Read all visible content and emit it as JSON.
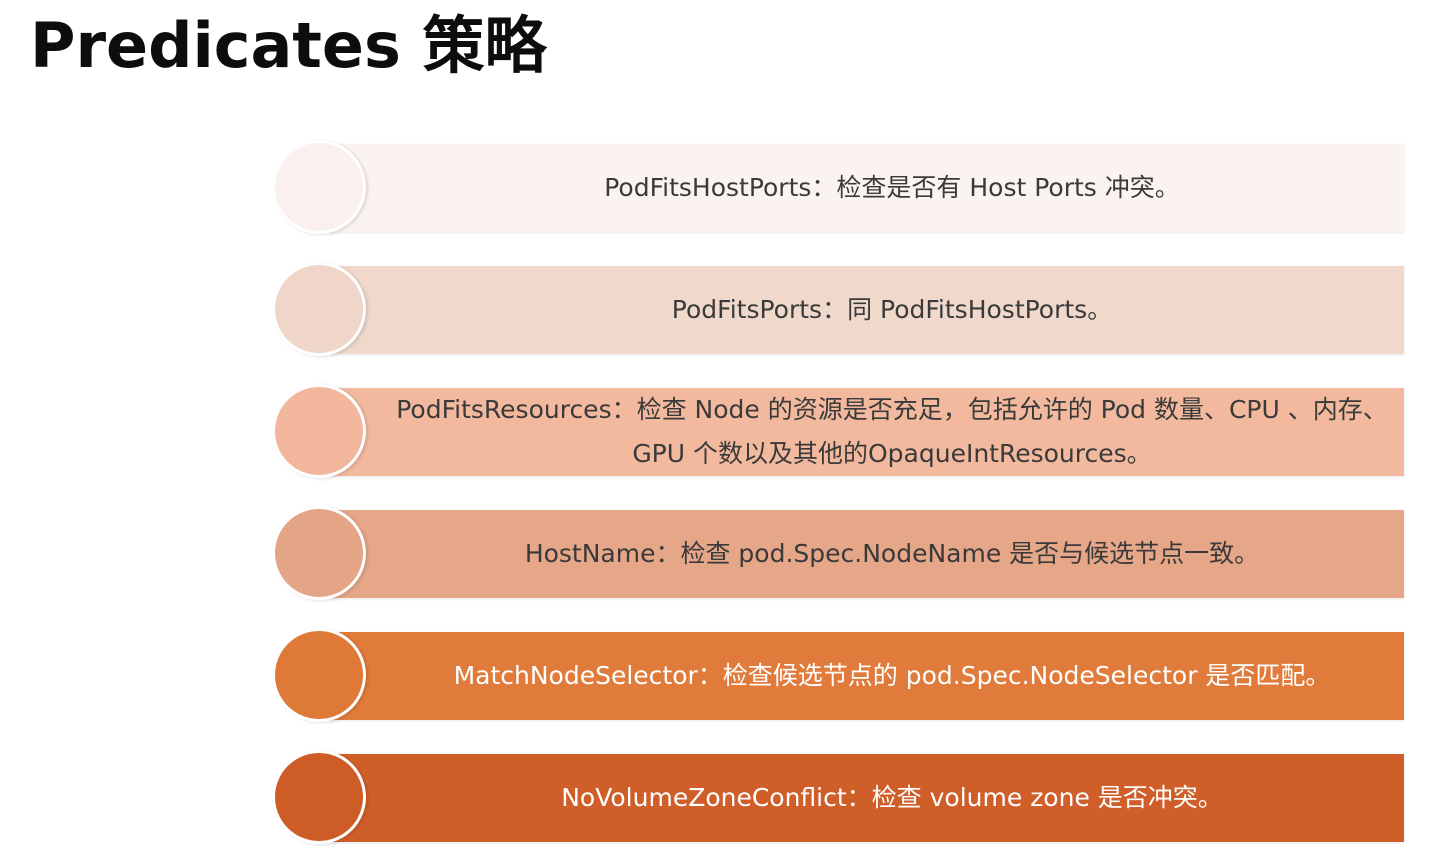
{
  "title": "Predicates 策略",
  "items": [
    {
      "text": "PodFitsHostPorts：检查是否有 Host Ports 冲突。",
      "bar_color": "#fbf3f0",
      "circle_color": "#faf1ee"
    },
    {
      "text": "PodFitsPorts：同 PodFitsHostPorts。",
      "bar_color": "#f0d8cb",
      "circle_color": "#efd6c9"
    },
    {
      "text": "PodFitsResources：检查 Node 的资源是否充足，包括允许的 Pod 数量、CPU 、内存、GPU 个数以及其他的OpaqueIntResources。",
      "bar_color": "#f2b99e",
      "circle_color": "#f1b69b"
    },
    {
      "text": "HostName：检查 pod.Spec.NodeName 是否与候选节点一致。",
      "bar_color": "#e6a688",
      "circle_color": "#e4a486"
    },
    {
      "text": "MatchNodeSelector：检查候选节点的 pod.Spec.NodeSelector 是否匹配。",
      "bar_color": "#e07b3b",
      "circle_color": "#df7938"
    },
    {
      "text": "NoVolumeZoneConflict：检查 volume zone 是否冲突。",
      "bar_color": "#d05e29",
      "circle_color": "#ce5c27"
    }
  ]
}
